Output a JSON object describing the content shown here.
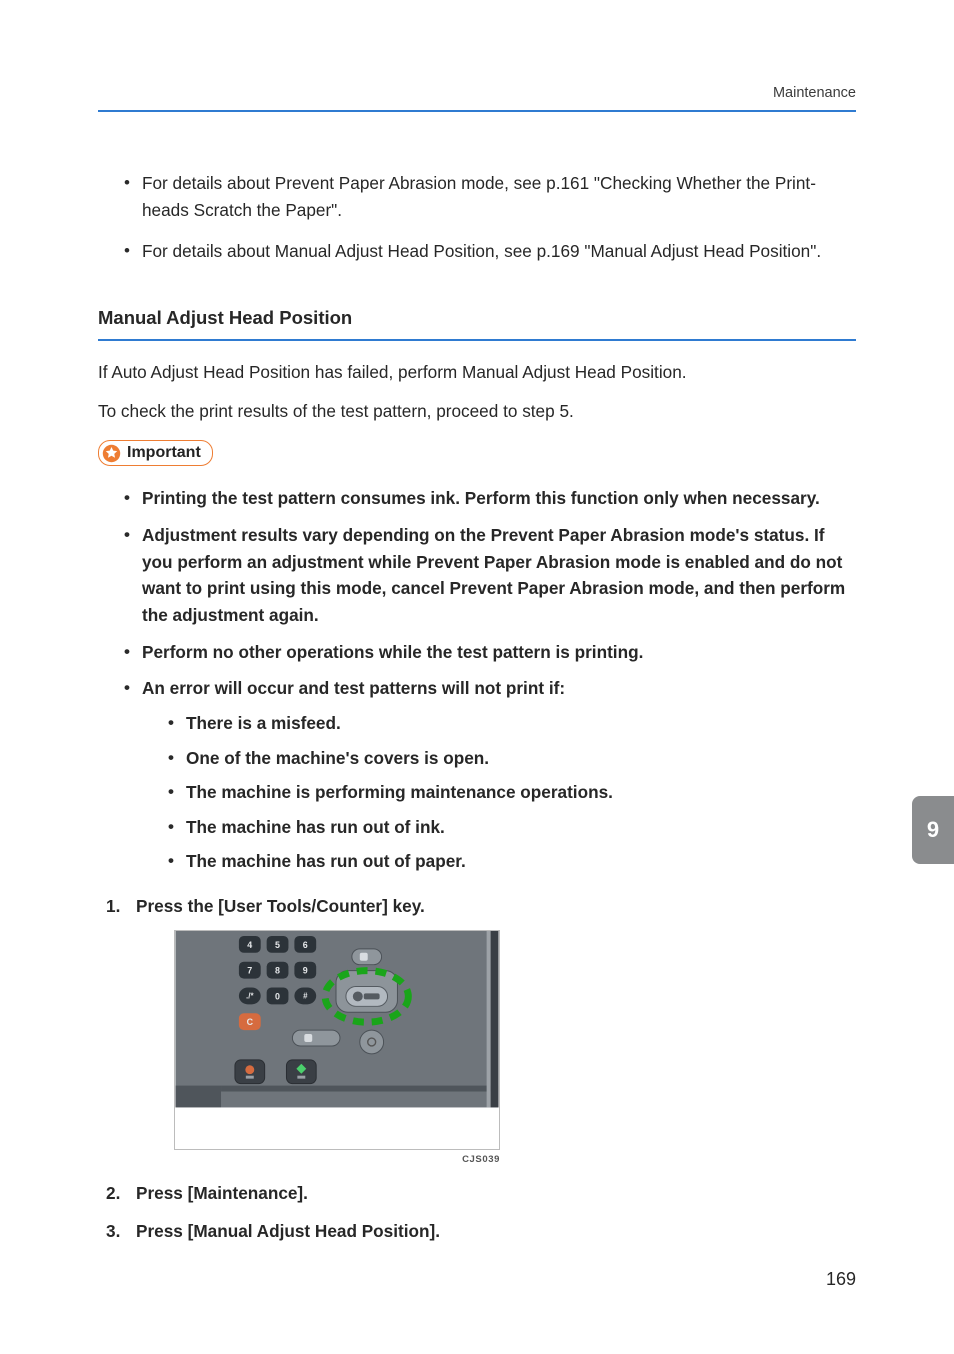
{
  "header": {
    "running_head": "Maintenance"
  },
  "intro_bullets": [
    "For details about Prevent Paper Abrasion mode, see p.161 \"Checking Whether the Print-heads Scratch the Paper\".",
    "For details about Manual Adjust Head Position, see p.169 \"Manual Adjust Head Position\"."
  ],
  "section": {
    "title": "Manual Adjust Head Position",
    "p1": "If Auto Adjust Head Position has failed, perform Manual Adjust Head Position.",
    "p2": "To check the print results of the test pattern, proceed to step 5."
  },
  "callout": {
    "label": "Important"
  },
  "important_bullets": [
    "Printing the test pattern consumes ink. Perform this function only when necessary.",
    "Adjustment results vary depending on the Prevent Paper Abrasion mode's status. If you perform an adjustment while Prevent Paper Abrasion mode is enabled and do not want to print using this mode, cancel Prevent Paper Abrasion mode, and then perform the adjustment again.",
    "Perform no other operations while the test pattern is printing.",
    "An error will occur and test patterns will not print if:"
  ],
  "error_sub_bullets": [
    "There is a misfeed.",
    "One of the machine's covers is open.",
    "The machine is performing maintenance operations.",
    "The machine has run out of ink.",
    "The machine has run out of paper."
  ],
  "steps": [
    "Press the [User Tools/Counter] key.",
    "Press [Maintenance].",
    "Press [Manual Adjust Head Position]."
  ],
  "figure": {
    "code": "CJS039",
    "keypad": {
      "r1": [
        "4",
        "5",
        "6"
      ],
      "r2": [
        "7",
        "8",
        "9"
      ],
      "r3": [
        "./*",
        "0",
        "#"
      ],
      "clear": "C"
    }
  },
  "thumb_tab": "9",
  "page_number": "169"
}
